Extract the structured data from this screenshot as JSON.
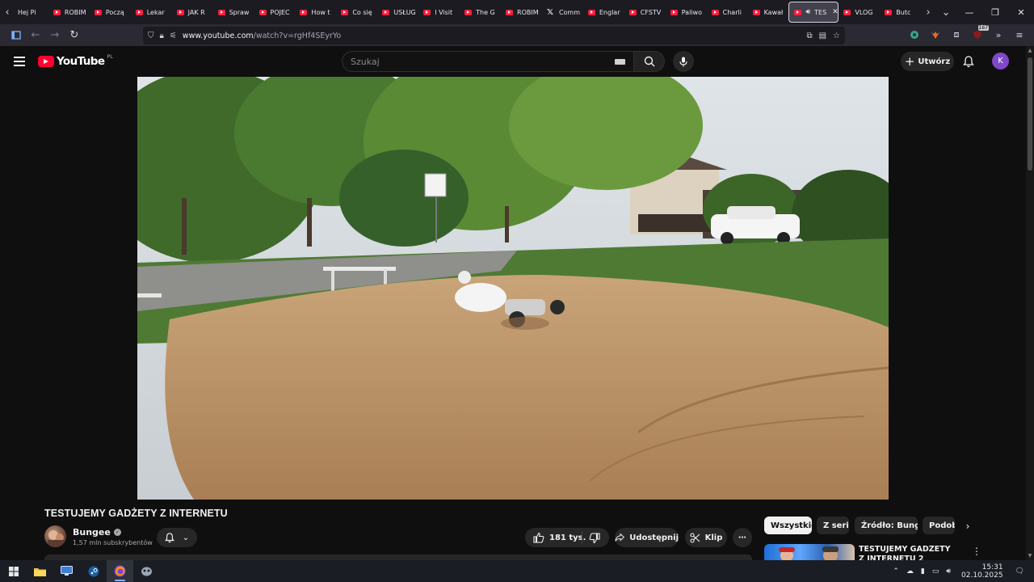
{
  "browser": {
    "tabs": [
      {
        "label": "Hej Pi",
        "icon": "youtube-favicon"
      },
      {
        "label": "ROBIM",
        "icon": "youtube-favicon"
      },
      {
        "label": "Począ",
        "icon": "youtube-favicon"
      },
      {
        "label": "Lekar",
        "icon": "youtube-favicon"
      },
      {
        "label": "JAK R",
        "icon": "youtube-favicon"
      },
      {
        "label": "Spraw",
        "icon": "youtube-favicon"
      },
      {
        "label": "POJEC",
        "icon": "youtube-favicon"
      },
      {
        "label": "How t",
        "icon": "youtube-favicon"
      },
      {
        "label": "Co się",
        "icon": "youtube-favicon"
      },
      {
        "label": "USŁUG",
        "icon": "youtube-favicon"
      },
      {
        "label": "I Visit",
        "icon": "youtube-favicon"
      },
      {
        "label": "The G",
        "icon": "youtube-favicon"
      },
      {
        "label": "ROBIM",
        "icon": "youtube-favicon"
      },
      {
        "label": "Comm",
        "icon": "x-favicon"
      },
      {
        "label": "Englar",
        "icon": "youtube-favicon"
      },
      {
        "label": "CFSTV",
        "icon": "youtube-favicon"
      },
      {
        "label": "Paliwo",
        "icon": "youtube-favicon"
      },
      {
        "label": "Charli",
        "icon": "youtube-favicon"
      },
      {
        "label": "Kawał",
        "icon": "youtube-favicon"
      },
      {
        "label": "TES",
        "icon": "youtube-favicon",
        "active": true
      },
      {
        "label": "VLOG",
        "icon": "youtube-favicon"
      },
      {
        "label": "Butc",
        "icon": "youtube-favicon"
      }
    ],
    "url_domain": "www.youtube.com",
    "url_path": "/watch?v=rgHf4SEyrYo",
    "ext_badge": "167"
  },
  "youtube": {
    "logo_text": "YouTube",
    "country_code": "PL",
    "search_placeholder": "Szukaj",
    "create_label": "Utwórz",
    "avatar_letter": "K"
  },
  "video": {
    "title": "TESTUJEMY GADŻETY Z INTERNETU",
    "channel_name": "Bungee",
    "subscribers": "1,57 mln subskrybentów",
    "likes": "181 tys.",
    "share_label": "Udostępnij",
    "clip_label": "Klip"
  },
  "sidebar": {
    "chips": [
      "Wszystkie",
      "Z serii",
      "Źródło: Bungee",
      "Podobne"
    ],
    "recommendation_title": "TESTUJEMY GADŻETY Z INTERNETU 2"
  },
  "taskbar": {
    "time": "15:31",
    "date": "02.10.2025",
    "apps": [
      "start",
      "file-explorer",
      "remote-desktop",
      "steam",
      "firefox",
      "app-cyborg"
    ]
  },
  "colors": {
    "youtube_red": "#ff0033",
    "avatar": "#7e48c9",
    "background": "#0f0f0f"
  }
}
